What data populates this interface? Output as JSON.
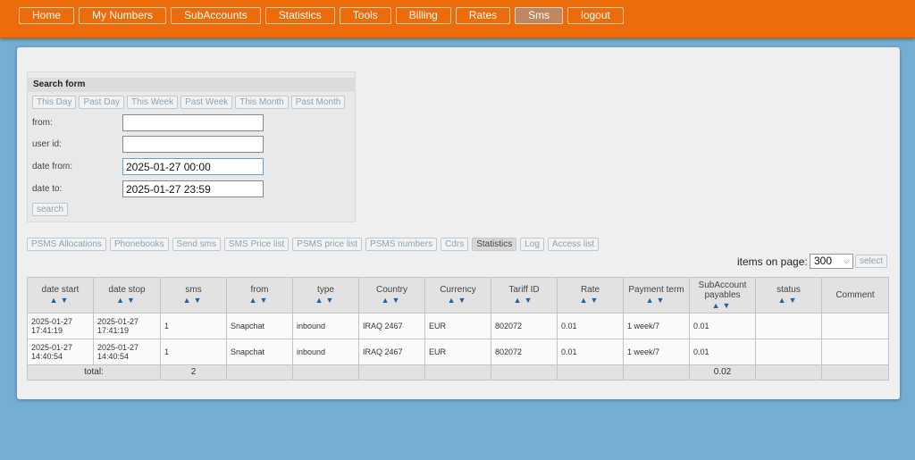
{
  "nav": [
    {
      "label": "Home",
      "active": false
    },
    {
      "label": "My Numbers",
      "active": false
    },
    {
      "label": "SubAccounts",
      "active": false
    },
    {
      "label": "Statistics",
      "active": false
    },
    {
      "label": "Tools",
      "active": false
    },
    {
      "label": "Billing",
      "active": false
    },
    {
      "label": "Rates",
      "active": false
    },
    {
      "label": "Sms",
      "active": true
    },
    {
      "label": "logout",
      "active": false
    }
  ],
  "search_form": {
    "title": "Search form",
    "period_buttons": [
      "This Day",
      "Past Day",
      "This Week",
      "Past Week",
      "This Month",
      "Past Month"
    ],
    "from_label": "from:",
    "from_value": "",
    "user_id_label": "user id:",
    "user_id_value": "",
    "date_from_label": "date from:",
    "date_from_value": "2025-01-27 00:00",
    "date_to_label": "date to:",
    "date_to_value": "2025-01-27 23:59",
    "search_button": "search"
  },
  "sub_tabs": [
    {
      "label": "PSMS Allocations",
      "selected": false
    },
    {
      "label": "Phonebooks",
      "selected": false
    },
    {
      "label": "Send sms",
      "selected": false
    },
    {
      "label": "SMS Price list",
      "selected": false
    },
    {
      "label": "PSMS price list",
      "selected": false
    },
    {
      "label": "PSMS numbers",
      "selected": false
    },
    {
      "label": "Cdrs",
      "selected": false
    },
    {
      "label": "Statistics",
      "selected": true
    },
    {
      "label": "Log",
      "selected": false
    },
    {
      "label": "Access list",
      "selected": false
    }
  ],
  "pagination": {
    "items_label": "items on page:",
    "items_value": "300",
    "select_button": "select"
  },
  "sort_arrows": "▲▼",
  "table": {
    "columns": [
      {
        "label": "date start",
        "sortable": true
      },
      {
        "label": "date stop",
        "sortable": true
      },
      {
        "label": "sms",
        "sortable": true
      },
      {
        "label": "from",
        "sortable": true
      },
      {
        "label": "type",
        "sortable": true
      },
      {
        "label": "Country",
        "sortable": true
      },
      {
        "label": "Currency",
        "sortable": true
      },
      {
        "label": "Tariff ID",
        "sortable": true
      },
      {
        "label": "Rate",
        "sortable": true
      },
      {
        "label": "Payment term",
        "sortable": true
      },
      {
        "label": "SubAccount payables",
        "sortable": true
      },
      {
        "label": "status",
        "sortable": true
      },
      {
        "label": "Comment",
        "sortable": false
      }
    ],
    "rows": [
      [
        "2025-01-27 17:41:19",
        "2025-01-27 17:41:19",
        "1",
        "Snapchat",
        "inbound",
        "IRAQ 2467",
        "EUR",
        "802072",
        "0.01",
        "1 week/7",
        "0.01",
        "",
        ""
      ],
      [
        "2025-01-27 14:40:54",
        "2025-01-27 14:40:54",
        "1",
        "Snapchat",
        "inbound",
        "IRAQ 2467",
        "EUR",
        "802072",
        "0.01",
        "1 week/7",
        "0.01",
        "",
        ""
      ]
    ],
    "total": {
      "label": "total:",
      "sms": "2",
      "payables": "0.02"
    }
  }
}
